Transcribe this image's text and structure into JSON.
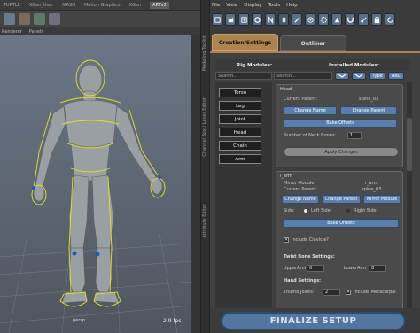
{
  "maya": {
    "shelf_tabs": [
      "TURTLE",
      "XGen_User",
      "MASH",
      "Motion Graphics",
      "XGen",
      "ARTv2"
    ],
    "viewport_menu": [
      "Renderer",
      "Panels"
    ],
    "camera_label": "persp",
    "fps": "2.9 fps"
  },
  "side_tabs": [
    "Modeling Toolkit",
    "Channel Box / Layer Editor",
    "Attribute Editor"
  ],
  "panel": {
    "menu": [
      "File",
      "View",
      "Display",
      "Tools",
      "Help"
    ],
    "toolbar_icons": [
      "create-icon",
      "save-icon",
      "skeleton-icon",
      "pose-icon",
      "mirror-icon",
      "symmetry-icon",
      "bone-icon",
      "rotate-icon",
      "settings-icon",
      "weights-icon",
      "magnet-icon",
      "joint-icon",
      "lock-icon",
      "refresh-icon"
    ],
    "tabs": {
      "creation": "Creation/Settings",
      "outliner": "Outliner"
    },
    "rig_modules_label": "Rig Modules:",
    "installed_modules_label": "Installed Modules:",
    "search_placeholder_left": "Search...",
    "search_placeholder_right": "Search...",
    "type_button": "Type",
    "abc_button": "ABC",
    "rig_modules": [
      "Torso",
      "Leg",
      "Joint",
      "Head",
      "Chain",
      "Arm"
    ],
    "head_module": {
      "name": "Head",
      "current_parent_label": "Current Parent:",
      "current_parent_value": "spine_03",
      "change_name": "Change Name",
      "change_parent": "Change Parent",
      "bake_offsets": "Bake Offsets",
      "neck_bones_label": "Number of Neck Bones:",
      "neck_bones_value": "1",
      "apply_changes": "Apply Changes"
    },
    "arm_module": {
      "name": "l_arm",
      "mirror_module_label": "Mirror Module:",
      "mirror_module_value": "r_arm",
      "current_parent_label": "Current Parent:",
      "current_parent_value": "spine_03",
      "change_name": "Change Name",
      "change_parent": "Change Parent",
      "mirror_module": "Mirror Module",
      "side_label": "Side:",
      "left_side": "Left Side",
      "right_side": "Right Side",
      "bake_offsets": "Bake Offsets",
      "include_clavicle": "Include Clavicle?",
      "twist_bone_settings": "Twist Bone Settings:",
      "upper_arm_label": "UpperArm",
      "upper_arm_value": "0",
      "lower_arm_label": "LowerArm",
      "lower_arm_value": "0",
      "hand_settings": "Hand Settings:",
      "thumb_joints_label": "Thumb Joints:",
      "thumb_joints_value": "2",
      "include_metacarpal": "Include Metacarpal"
    },
    "finalize": "FINALIZE SETUP"
  }
}
